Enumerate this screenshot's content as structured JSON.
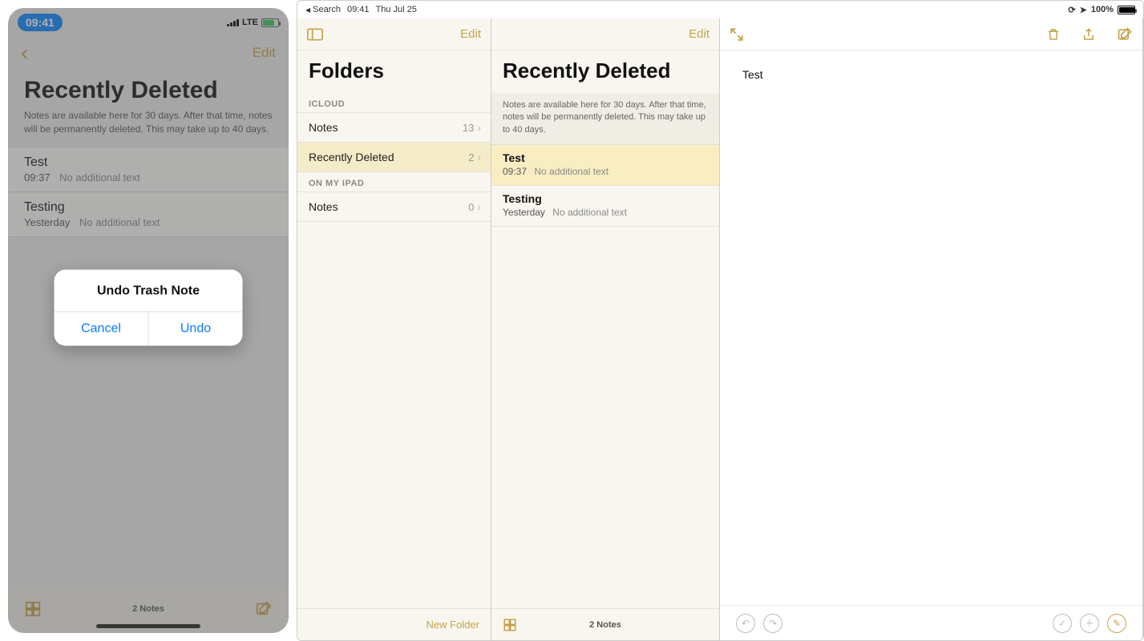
{
  "iphone": {
    "time": "09:41",
    "carrier": "LTE",
    "edit_label": "Edit",
    "title": "Recently Deleted",
    "subtitle": "Notes are available here for 30 days. After that time, notes will be permanently deleted. This may take up to 40 days.",
    "notes": [
      {
        "title": "Test",
        "time": "09:37",
        "extra": "No additional text"
      },
      {
        "title": "Testing",
        "time": "Yesterday",
        "extra": "No additional text"
      }
    ],
    "footer_count": "2 Notes",
    "dialog": {
      "title": "Undo Trash Note",
      "cancel": "Cancel",
      "undo": "Undo"
    }
  },
  "ipad": {
    "status": {
      "back": "Search",
      "time": "09:41",
      "date": "Thu Jul 25",
      "battery_pct": "100%"
    },
    "folders": {
      "title": "Folders",
      "edit_label": "Edit",
      "sections": [
        {
          "label": "ICLOUD",
          "rows": [
            {
              "name": "Notes",
              "count": "13",
              "selected": false
            },
            {
              "name": "Recently Deleted",
              "count": "2",
              "selected": true
            }
          ]
        },
        {
          "label": "ON MY IPAD",
          "rows": [
            {
              "name": "Notes",
              "count": "0",
              "selected": false
            }
          ]
        }
      ],
      "new_folder": "New Folder"
    },
    "notes_list": {
      "title": "Recently Deleted",
      "edit_label": "Edit",
      "subtitle": "Notes are available here for 30 days. After that time, notes will be permanently deleted. This may take up to 40 days.",
      "rows": [
        {
          "title": "Test",
          "time": "09:37",
          "extra": "No additional text",
          "selected": true
        },
        {
          "title": "Testing",
          "time": "Yesterday",
          "extra": "No additional text",
          "selected": false
        }
      ],
      "footer_count": "2 Notes"
    },
    "editor": {
      "content": "Test"
    }
  }
}
